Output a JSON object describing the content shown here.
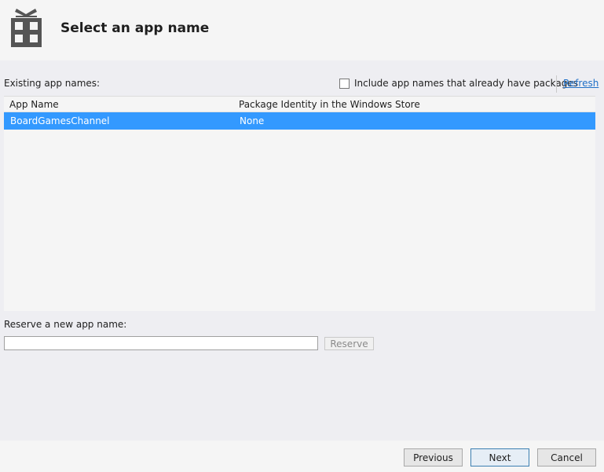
{
  "header": {
    "title": "Select an app name",
    "icon": "gift-box-icon"
  },
  "existing": {
    "label": "Existing app names:",
    "include_label": "Include app names that already have packages",
    "include_checked": false,
    "refresh_label": "Refresh"
  },
  "table": {
    "columns": [
      "App Name",
      "Package Identity in the Windows Store"
    ],
    "rows": [
      {
        "app_name": "BoardGamesChannel",
        "package_identity": "None",
        "selected": true
      }
    ]
  },
  "reserve": {
    "label": "Reserve a new app name:",
    "value": "",
    "button_label": "Reserve"
  },
  "footer": {
    "previous_label": "Previous",
    "next_label": "Next",
    "cancel_label": "Cancel"
  },
  "colors": {
    "selection": "#3399ff",
    "link": "#1e6fc7",
    "icon": "#555555"
  }
}
